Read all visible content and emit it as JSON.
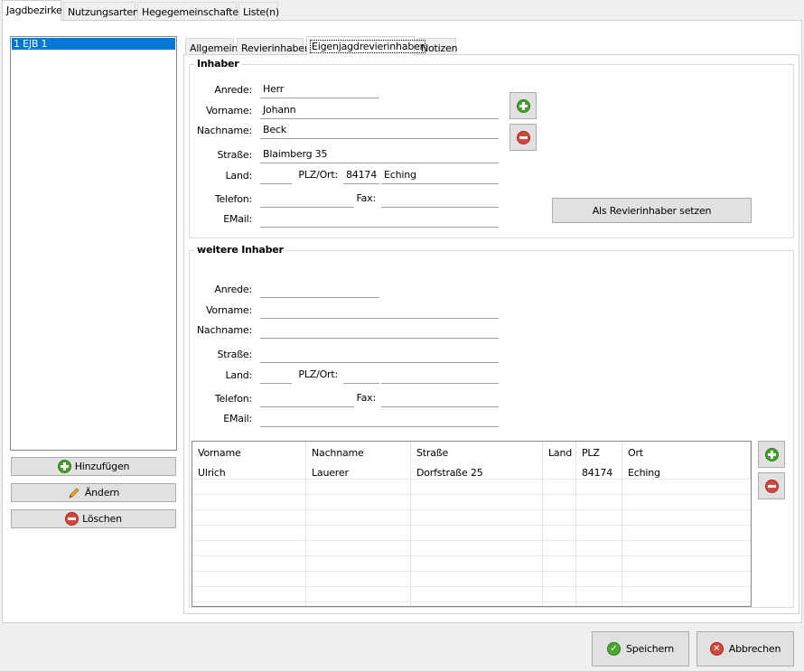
{
  "main_tabs": [
    "Jagdbezirke",
    "Nutzungsarten",
    "Hegegemeinschaften",
    "Liste(n)"
  ],
  "list": {
    "items": [
      "1 EJB 1"
    ]
  },
  "left_buttons": {
    "add": "Hinzufügen",
    "edit": "Ändern",
    "delete": "Löschen"
  },
  "sub_tabs": [
    "Allgemein",
    "Revierinhaber",
    "Eigenjagdrevierinhaber",
    "Notizen"
  ],
  "owner": {
    "title": "Inhaber",
    "labels": {
      "anrede": "Anrede:",
      "vorname": "Vorname:",
      "nachname": "Nachname:",
      "strasse": "Straße:",
      "land": "Land:",
      "plz_ort": "PLZ/Ort:",
      "telefon": "Telefon:",
      "fax": "Fax:",
      "email": "EMail:"
    },
    "values": {
      "anrede": "Herr",
      "vorname": "Johann",
      "nachname": "Beck",
      "strasse": "Blaimberg 35",
      "land": "",
      "plz": "84174",
      "ort": "Eching",
      "telefon": "",
      "fax": "",
      "email": ""
    },
    "set_button": "Als Revierinhaber setzen"
  },
  "more": {
    "title": "weitere Inhaber",
    "labels": {
      "anrede": "Anrede:",
      "vorname": "Vorname:",
      "nachname": "Nachname:",
      "strasse": "Straße:",
      "land": "Land:",
      "plz_ort": "PLZ/Ort:",
      "telefon": "Telefon:",
      "fax": "Fax:",
      "email": "EMail:"
    },
    "values": {
      "anrede": "",
      "vorname": "",
      "nachname": "",
      "strasse": "",
      "land": "",
      "plz": "",
      "ort": "",
      "telefon": "",
      "fax": "",
      "email": ""
    }
  },
  "grid": {
    "columns": [
      "Vorname",
      "Nachname",
      "Straße",
      "Land",
      "PLZ",
      "Ort"
    ],
    "rows": [
      [
        "Ulrich",
        "Lauerer",
        "Dorfstraße 25",
        "",
        "84174",
        "Eching"
      ]
    ]
  },
  "footer": {
    "save": "Speichern",
    "cancel": "Abbrechen"
  },
  "icons": {
    "add": "plus-circle-icon",
    "remove": "minus-circle-icon",
    "edit": "pencil-icon",
    "save": "check-icon",
    "cancel": "x-circle-icon"
  },
  "colors": {
    "selection": "#0078d7",
    "add_green": "#45a12e",
    "remove_red": "#d7463b"
  }
}
